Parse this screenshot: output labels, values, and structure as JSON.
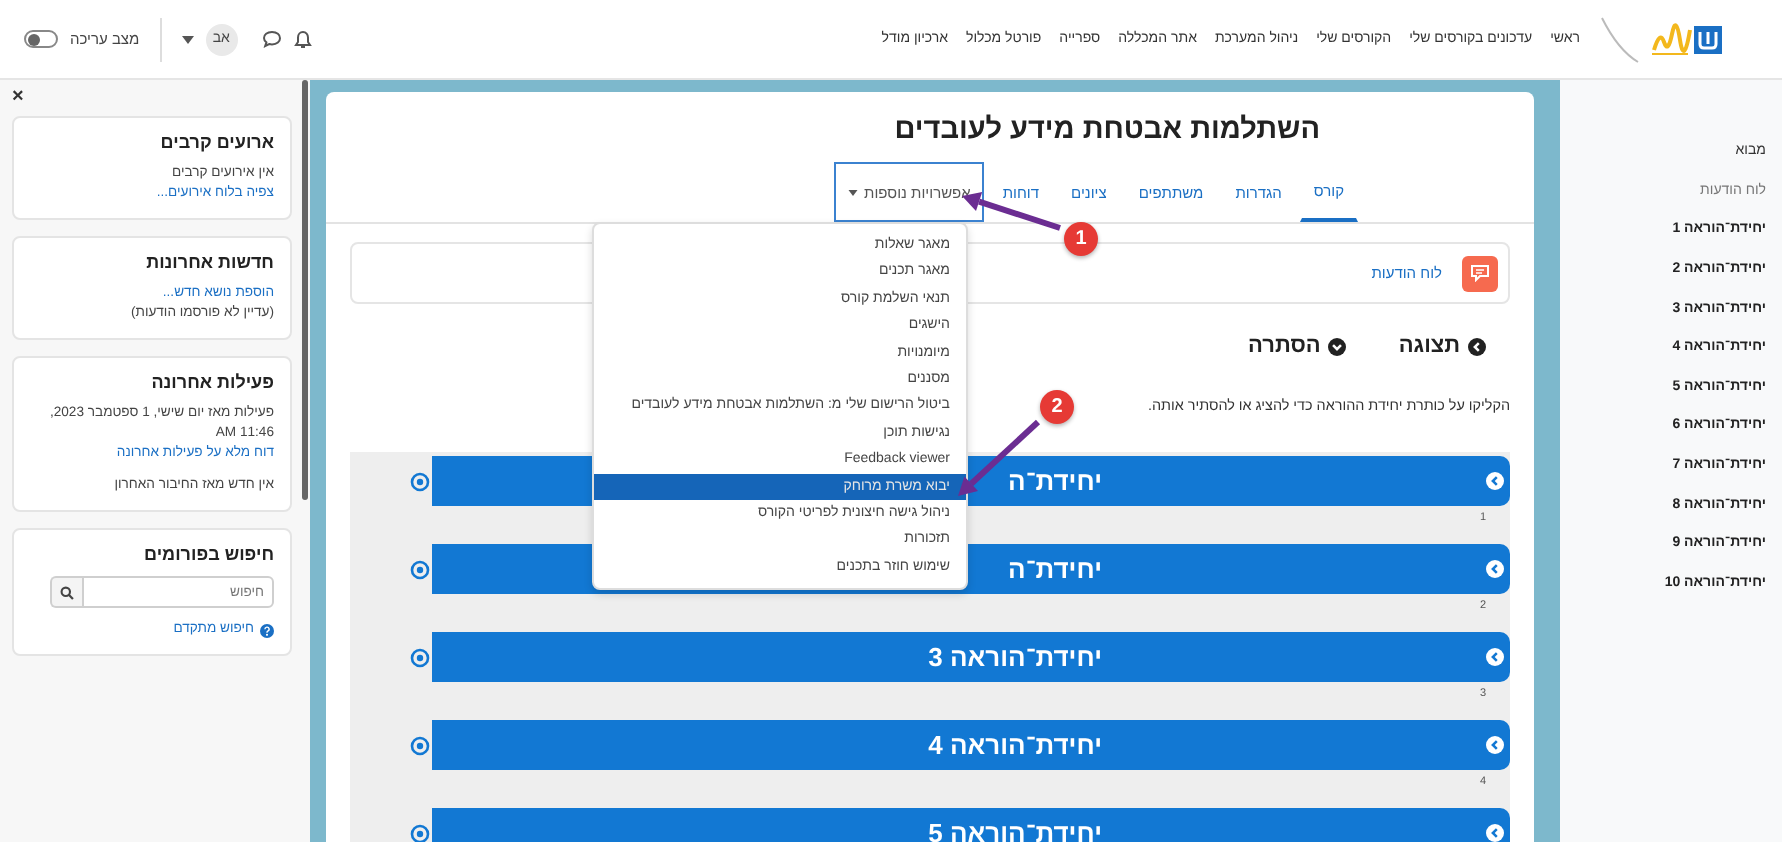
{
  "topbar": {
    "nav": [
      "ראשי",
      "עדכונים בקורסים שלי",
      "הקורסים שלי",
      "ניהול המערכת",
      "אתר המכללה",
      "ספרייה",
      "פורטל מכלול",
      "ארכיון מודל"
    ],
    "avatar": "אב",
    "edit_mode": {
      "label": "מצב עריכה",
      "on": false
    }
  },
  "drawer": {
    "close": "×",
    "blocks": [
      {
        "title": "ארועים קרבים",
        "items": [
          {
            "kind": "text",
            "text": "אין אירועים קרבים"
          },
          {
            "kind": "link",
            "text": "צפיה בלוח אירועים..."
          }
        ]
      },
      {
        "title": "חדשות אחרונות",
        "items": [
          {
            "kind": "link",
            "text": "הוספת נושא חדש..."
          },
          {
            "kind": "text",
            "text": "(עדיין לא פורסמו הודעות)"
          }
        ]
      },
      {
        "title": "פעילות אחרונה",
        "items": [
          {
            "kind": "text",
            "text": "פעילות מאז יום שישי, 1 ספטמבר 2023, 11:46 AM"
          },
          {
            "kind": "link",
            "text": "דוח מלא על פעילות אחרונה"
          },
          {
            "kind": "gap_text",
            "text": "אין חדש מאז החיבור האחרון"
          }
        ]
      },
      {
        "title": "חיפוש בפורומים",
        "items": [
          {
            "kind": "search",
            "placeholder": "חיפוש"
          },
          {
            "kind": "help_link",
            "text": "חיפוש מתקדם"
          }
        ]
      }
    ]
  },
  "main": {
    "title": "השתלמות אבטחת מידע לעובדים",
    "tabs": [
      {
        "label": "קורס",
        "selected": true,
        "expanded": false
      },
      {
        "label": "הגדרות",
        "selected": false,
        "expanded": false
      },
      {
        "label": "משתתפים",
        "selected": false,
        "expanded": false
      },
      {
        "label": "ציונים",
        "selected": false,
        "expanded": false
      },
      {
        "label": "דוחות",
        "selected": false,
        "expanded": false
      },
      {
        "label": "אפשרויות נוספות",
        "selected": false,
        "expanded": true
      }
    ],
    "notice": {
      "link": "לוח הודעות"
    },
    "view_controls": [
      {
        "kind": "expand",
        "label": "תצוגה"
      },
      {
        "kind": "collapse",
        "label": "הסתרה"
      }
    ],
    "instruction": "הקליקו על כותרת יחידת ההוראה כדי להציג או להסתיר אותה.",
    "units": [
      {
        "title": "יחידת־ה",
        "number": "1"
      },
      {
        "title": "יחידת־ה",
        "number": "2"
      },
      {
        "title": "יחידת־הוראה 3",
        "number": "3"
      },
      {
        "title": "יחידת־הוראה 4",
        "number": "4"
      },
      {
        "title": "יחידת־הוראה 5"
      }
    ]
  },
  "menu": {
    "items": [
      {
        "label": "מאגר שאלות",
        "selected": false
      },
      {
        "label": "מאגר תכנים",
        "selected": false
      },
      {
        "label": "תנאי השלמת קורס",
        "selected": false
      },
      {
        "label": "הישגים",
        "selected": false
      },
      {
        "label": "מיומנויות",
        "selected": false
      },
      {
        "label": "מסננים",
        "selected": false
      },
      {
        "label": "ביטול הרישום שלי מ: השתלמות אבטחת מידע לעובדים",
        "selected": false
      },
      {
        "label": "נגישות תוכן",
        "selected": false
      },
      {
        "label": "Feedback viewer",
        "selected": false
      },
      {
        "label": "יבוא משרת מרוחק",
        "selected": true
      },
      {
        "label": "ניהול גישה חיצונית לפריטי הקורס",
        "selected": false
      },
      {
        "label": "תזכורות",
        "selected": false
      },
      {
        "label": "שימוש חוזר בתכנים",
        "selected": false
      }
    ]
  },
  "course_index": [
    {
      "kind": "section",
      "label": "מבוא"
    },
    {
      "kind": "activity",
      "label": "לוח הודעות"
    },
    {
      "kind": "unit",
      "label": "יחידת־הוראה 1"
    },
    {
      "kind": "unit",
      "label": "יחידת־הוראה 2"
    },
    {
      "kind": "unit",
      "label": "יחידת־הוראה 3"
    },
    {
      "kind": "unit",
      "label": "יחידת־הוראה 4"
    },
    {
      "kind": "unit",
      "label": "יחידת־הוראה 5"
    },
    {
      "kind": "unit",
      "label": "יחידת־הוראה 6"
    },
    {
      "kind": "unit",
      "label": "יחידת־הוראה 7"
    },
    {
      "kind": "unit",
      "label": "יחידת־הוראה 8"
    },
    {
      "kind": "unit",
      "label": "יחידת־הוראה 9"
    },
    {
      "kind": "unit",
      "label": "יחידת־הוראה 10"
    }
  ],
  "annotations": [
    {
      "number": "1"
    },
    {
      "number": "2"
    }
  ]
}
